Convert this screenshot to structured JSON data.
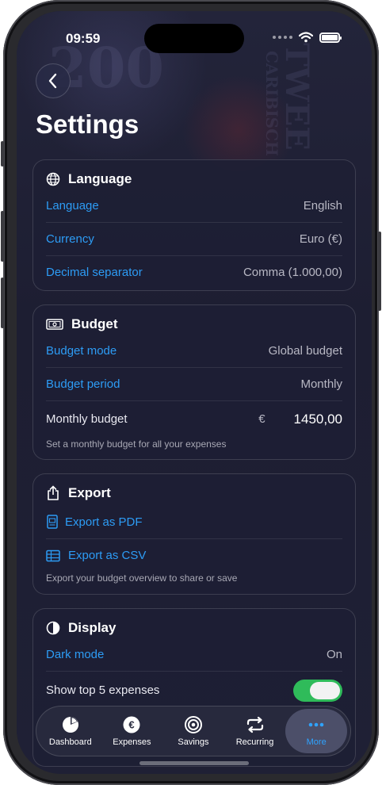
{
  "status": {
    "time": "09:59"
  },
  "header": {
    "title": "Settings"
  },
  "sections": {
    "language": {
      "title": "Language",
      "rows": [
        {
          "label": "Language",
          "value": "English"
        },
        {
          "label": "Currency",
          "value": "Euro (€)"
        },
        {
          "label": "Decimal separator",
          "value": "Comma (1.000,00)"
        }
      ]
    },
    "budget": {
      "title": "Budget",
      "rows": [
        {
          "label": "Budget mode",
          "value": "Global budget"
        },
        {
          "label": "Budget period",
          "value": "Monthly"
        }
      ],
      "monthly": {
        "label": "Monthly budget",
        "currency_symbol": "€",
        "amount": "1450,00"
      },
      "hint": "Set a monthly budget for all your expenses"
    },
    "export": {
      "title": "Export",
      "pdf_label": "Export as PDF",
      "csv_label": "Export as CSV",
      "hint": "Export your budget overview to share or save"
    },
    "display": {
      "title": "Display",
      "dark_mode_label": "Dark mode",
      "dark_mode_value": "On",
      "top5_label": "Show top 5 expenses",
      "top5_on": true
    }
  },
  "tabs": [
    {
      "label": "Dashboard",
      "icon": "pie-chart-icon"
    },
    {
      "label": "Expenses",
      "icon": "euro-coin-icon"
    },
    {
      "label": "Savings",
      "icon": "target-icon"
    },
    {
      "label": "Recurring",
      "icon": "repeat-icon"
    },
    {
      "label": "More",
      "icon": "ellipsis-icon",
      "active": true
    }
  ],
  "colors": {
    "accent": "#2d9cf5",
    "toggle_on": "#2fbb5a",
    "background": "#1c1d30"
  }
}
